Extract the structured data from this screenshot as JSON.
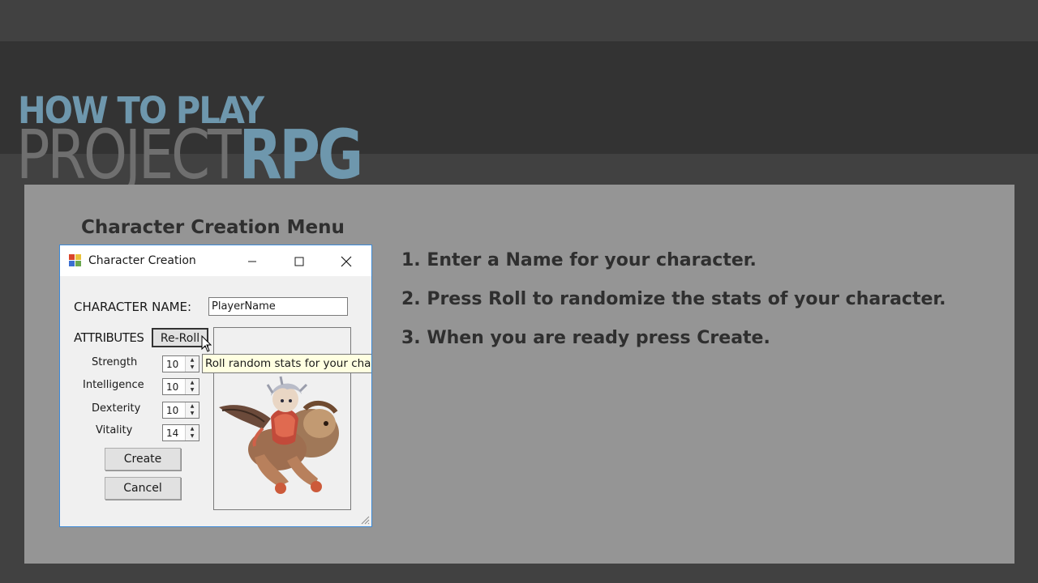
{
  "banner": {
    "line1": "HOW TO PLAY",
    "line2_part1": "PROJECT",
    "line2_part2": "RPG"
  },
  "section_title": "Character Creation Menu",
  "instructions": [
    "1. Enter a Name for your character.",
    "2. Press Roll to randomize the stats of your character.",
    "3. When you are ready press Create."
  ],
  "window": {
    "title": "Character Creation",
    "icon": "app-icon",
    "controls": {
      "minimize": "minimize-icon",
      "maximize": "maximize-icon",
      "close": "close-icon"
    }
  },
  "form": {
    "name_label": "CHARACTER NAME:",
    "name_value": "PlayerName",
    "attributes_label": "ATTRIBUTES",
    "reroll_label": "Re-Roll",
    "tooltip": "Roll random stats for your chara",
    "stats": [
      {
        "label": "Strength",
        "value": "10"
      },
      {
        "label": "Intelligence",
        "value": "10"
      },
      {
        "label": "Dexterity",
        "value": "10"
      },
      {
        "label": "Vitality",
        "value": "14"
      }
    ],
    "create_label": "Create",
    "cancel_label": "Cancel",
    "portrait": "character-portrait"
  },
  "colors": {
    "accent": "#6e97ad",
    "background": "#414141",
    "banner": "#333333",
    "panel": "#959595",
    "window_border": "#3c8ad8",
    "tooltip_bg": "#ffffe1"
  }
}
